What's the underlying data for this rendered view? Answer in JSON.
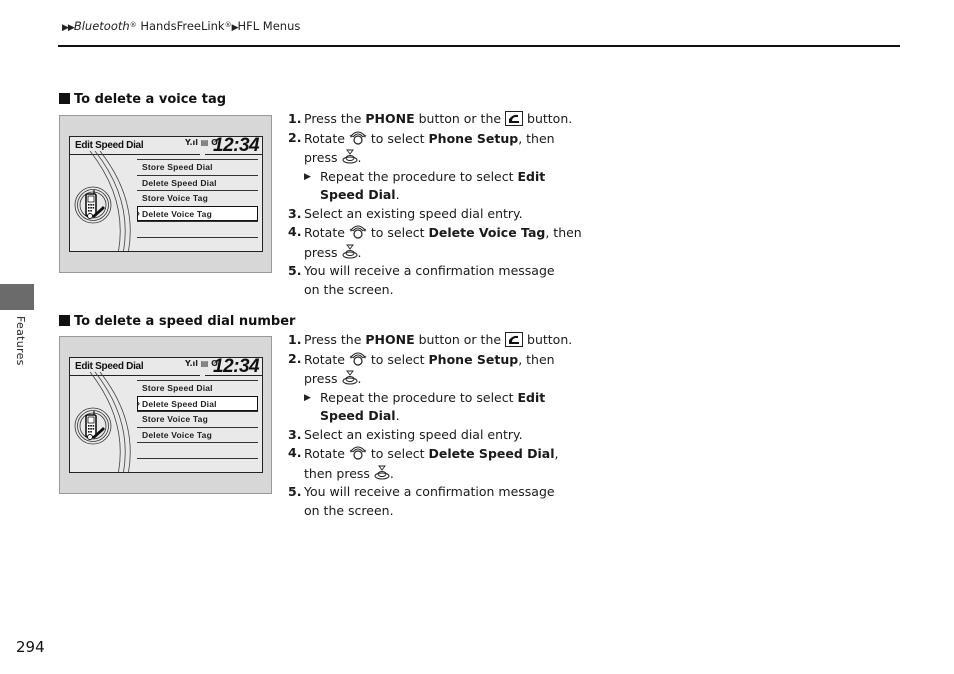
{
  "header": {
    "breadcrumb": [
      {
        "text": "Bluetooth",
        "italic": true,
        "reg": true
      },
      {
        "text": " HandsFreeLink",
        "reg": true
      },
      {
        "text": "HFL Menus"
      }
    ],
    "breadcrumb_part1": "Bluetooth",
    "breadcrumb_part2": " HandsFreeLink",
    "breadcrumb_part3": "HFL Menus",
    "reg_mark": "®"
  },
  "side_tab": {
    "label": "Features",
    "color": "#6b6b6b"
  },
  "page_number": "294",
  "sections": [
    {
      "heading": "To delete a voice tag",
      "screen": {
        "title": "Edit Speed Dial",
        "status_icons": "Y.ıl ▤ ʘ",
        "clock": "12:34",
        "menu": [
          "Store Speed Dial",
          "Delete Speed Dial",
          "Store Voice Tag",
          "Delete Voice Tag",
          ""
        ],
        "selected_index": 3
      },
      "steps": {
        "s1": {
          "num": "1.",
          "a": "Press the ",
          "b": "PHONE",
          "c": " button or the ",
          "d": " button."
        },
        "s2": {
          "num": "2.",
          "a": "Rotate ",
          "b": " to select ",
          "c": "Phone Setup",
          "d": ", then press ",
          "e": "."
        },
        "sub": {
          "a": "Repeat the procedure to select ",
          "b": "Edit Speed Dial",
          "c": "."
        },
        "s3": {
          "num": "3.",
          "a": "Select an existing speed dial entry."
        },
        "s4": {
          "num": "4.",
          "a": "Rotate ",
          "b": " to select ",
          "c": "Delete Voice Tag",
          "d": ", then press ",
          "e": "."
        },
        "s5": {
          "num": "5.",
          "a": "You will receive a confirmation message on the screen."
        }
      }
    },
    {
      "heading": "To delete a speed dial number",
      "screen": {
        "title": "Edit Speed Dial",
        "status_icons": "Y.ıl ▤ ʘ",
        "clock": "12:34",
        "menu": [
          "Store Speed Dial",
          "Delete Speed Dial",
          "Store Voice Tag",
          "Delete Voice Tag",
          ""
        ],
        "selected_index": 1
      },
      "steps": {
        "s1": {
          "num": "1.",
          "a": "Press the ",
          "b": "PHONE",
          "c": " button or the ",
          "d": " button."
        },
        "s2": {
          "num": "2.",
          "a": "Rotate ",
          "b": " to select ",
          "c": "Phone Setup",
          "d": ", then press ",
          "e": "."
        },
        "sub": {
          "a": "Repeat the procedure to select ",
          "b": "Edit Speed Dial",
          "c": "."
        },
        "s3": {
          "num": "3.",
          "a": "Select an existing speed dial entry."
        },
        "s4": {
          "num": "4.",
          "a": "Rotate ",
          "b": " to select ",
          "c": "Delete Speed Dial",
          "d": ", then press ",
          "e": "."
        },
        "s5": {
          "num": "5.",
          "a": "You will receive a confirmation message on the screen."
        }
      }
    }
  ],
  "icons": {
    "breadcrumb_arrow": "triangle-right-icon",
    "phone_button": "phone-button-icon",
    "rotate_knob": "interface-dial-rotate-icon",
    "press_knob": "interface-dial-press-icon"
  }
}
